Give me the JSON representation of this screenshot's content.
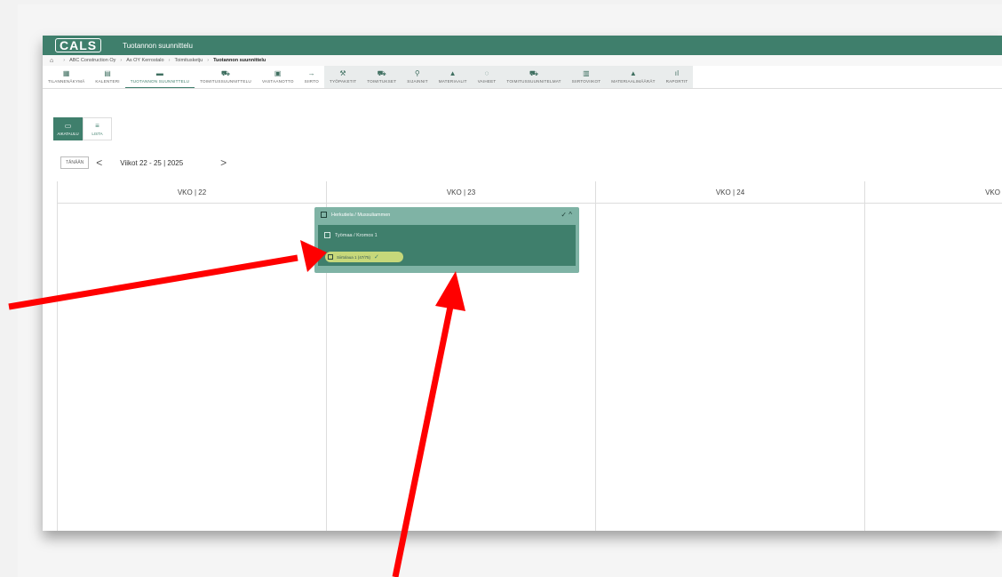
{
  "app": {
    "logo": "CALS",
    "title": "Tuotannon suunnittelu"
  },
  "breadcrumb": [
    "ABC Construction Oy",
    "As OY Kerrostalo",
    "Toimitusketju",
    "Tuotannon suunnittelu"
  ],
  "nav": {
    "items": [
      {
        "label": "TILANNENÄKYMÄ",
        "icon": "▦"
      },
      {
        "label": "KALENTERI",
        "icon": "▤"
      },
      {
        "label": "TUOTANNON SUUNNITTELU",
        "icon": "▬"
      },
      {
        "label": "TOIMITUSSUUNNITTELU",
        "icon": "⛟"
      },
      {
        "label": "VASTAANOTTO",
        "icon": "▣"
      },
      {
        "label": "SIIRTO",
        "icon": "→"
      }
    ],
    "group": [
      {
        "label": "TYÖPAKETIT",
        "icon": "⚒"
      },
      {
        "label": "TOIMITUKSET",
        "icon": "⛟"
      },
      {
        "label": "SIJAINNIT",
        "icon": "⚲"
      },
      {
        "label": "MATERIAALIT",
        "icon": "▲"
      },
      {
        "label": "VAIHEET",
        "icon": "◌"
      },
      {
        "label": "TOIMITUSSUUNNITELMAT",
        "icon": "⛟"
      },
      {
        "label": "SIIRTOVIIKOT",
        "icon": "▥"
      },
      {
        "label": "MATERIAALIMÄÄRÄT",
        "icon": "▲"
      },
      {
        "label": "RAPORTIT",
        "icon": "ıl"
      }
    ]
  },
  "view": {
    "schedule": "AIKATAULU",
    "list": "LISTA"
  },
  "datebar": {
    "today": "TÄNÄÄN",
    "prev": "<",
    "range": "Viikot 22 - 25 | 2025",
    "next": ">"
  },
  "weeks": [
    "VKO | 22",
    "VKO | 23",
    "VKO | 24",
    "VKO"
  ],
  "card": {
    "title": "Herkutiela / Mussuliammen",
    "actions": "✓ ^",
    "sub_title": "Työmaa / Kromos 1",
    "task_label": "Siirtolaua 1 (47/75)",
    "task_check": "✓"
  },
  "colors": {
    "brand": "#3f7f6c",
    "card": "#7fb3a5",
    "task": "#c6d87a",
    "annotation": "#ff0000"
  }
}
